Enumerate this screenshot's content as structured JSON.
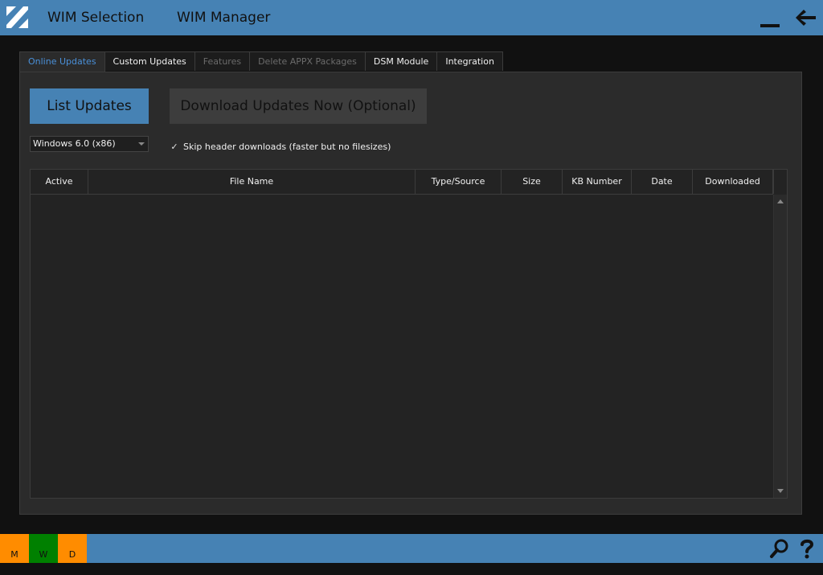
{
  "topbar": {
    "menu_items": [
      "WIM Selection",
      "WIM Manager"
    ]
  },
  "tabs": [
    {
      "label": "Online Updates",
      "state": "active"
    },
    {
      "label": "Custom Updates",
      "state": "normal"
    },
    {
      "label": "Features",
      "state": "disabled"
    },
    {
      "label": "Delete APPX Packages",
      "state": "disabled"
    },
    {
      "label": "DSM Module",
      "state": "normal"
    },
    {
      "label": "Integration",
      "state": "normal"
    }
  ],
  "actions": {
    "list_updates_label": "List Updates",
    "download_updates_label": "Download Updates Now (Optional)"
  },
  "os_select": {
    "value": "Windows 6.0 (x86)"
  },
  "skip_header": {
    "checked": true,
    "label": "Skip header downloads (faster but no filesizes)"
  },
  "grid": {
    "columns": [
      "Active",
      "File Name",
      "Type/Source",
      "Size",
      "KB Number",
      "Date",
      "Downloaded"
    ],
    "rows": []
  },
  "statusbar": {
    "cells": [
      {
        "label": "M",
        "color": "#ff8c00"
      },
      {
        "label": "W",
        "color": "#008000"
      },
      {
        "label": "D",
        "color": "#ff8c00"
      }
    ]
  },
  "colors": {
    "accent": "#4682b4",
    "background": "#111111",
    "panel": "#2b2b2b",
    "active_tab_text": "#4a90d9"
  },
  "icons": {
    "logo": "app-logo",
    "minimize": "minimize-icon",
    "back": "back-arrow-icon",
    "search": "search-icon",
    "help": "help-icon"
  }
}
